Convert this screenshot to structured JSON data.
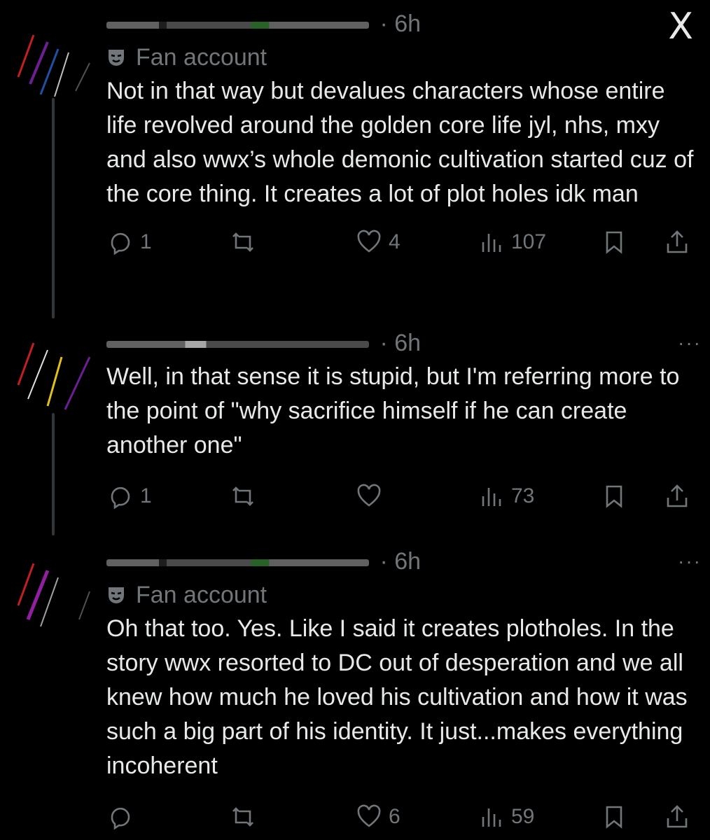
{
  "close_label": "X",
  "tweets": [
    {
      "time": "· 6h",
      "badge": "Fan account",
      "text": "Not in that way but devalues characters whose entire life revolved around the golden core life jyl, nhs, mxy and also wwx’s whole demonic cultivation started cuz of the core thing. It creates a lot of plot holes idk man",
      "replies": "1",
      "reposts": "",
      "likes": "4",
      "views": "107"
    },
    {
      "time": "· 6h",
      "badge": "",
      "text": "Well, in that sense it is stupid, but I'm referring more to the point of \"why sacrifice himself if he can create another one\"",
      "replies": "1",
      "reposts": "",
      "likes": "",
      "views": "73"
    },
    {
      "time": "· 6h",
      "badge": "Fan account",
      "text": "Oh that too. Yes. Like I said it creates plotholes. In the story wwx resorted to DC out of desperation and we all knew how much he loved his cultivation and how it was such a big part of his identity. It just...makes everything incoherent",
      "replies": "",
      "reposts": "",
      "likes": "6",
      "views": "59"
    }
  ],
  "more_label": "···",
  "colors": {
    "background": "#000000",
    "text": "#e7e9ea",
    "muted": "#71767b",
    "thread": "#333639"
  }
}
